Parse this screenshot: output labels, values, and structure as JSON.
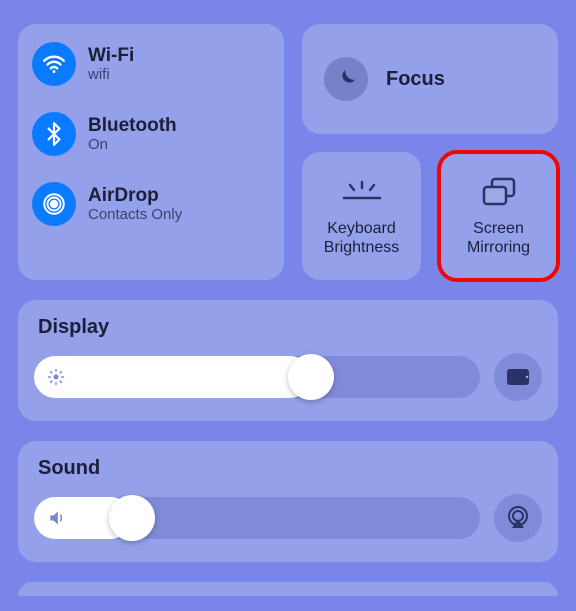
{
  "connectivity": {
    "wifi": {
      "title": "Wi-Fi",
      "sub": "wifi"
    },
    "bluetooth": {
      "title": "Bluetooth",
      "sub": "On"
    },
    "airdrop": {
      "title": "AirDrop",
      "sub": "Contacts Only"
    }
  },
  "focus": {
    "title": "Focus"
  },
  "tiles": {
    "keyboard_brightness": "Keyboard\nBrightness",
    "screen_mirroring": "Screen\nMirroring"
  },
  "display": {
    "title": "Display",
    "percent": 62
  },
  "sound": {
    "title": "Sound",
    "percent": 22
  }
}
